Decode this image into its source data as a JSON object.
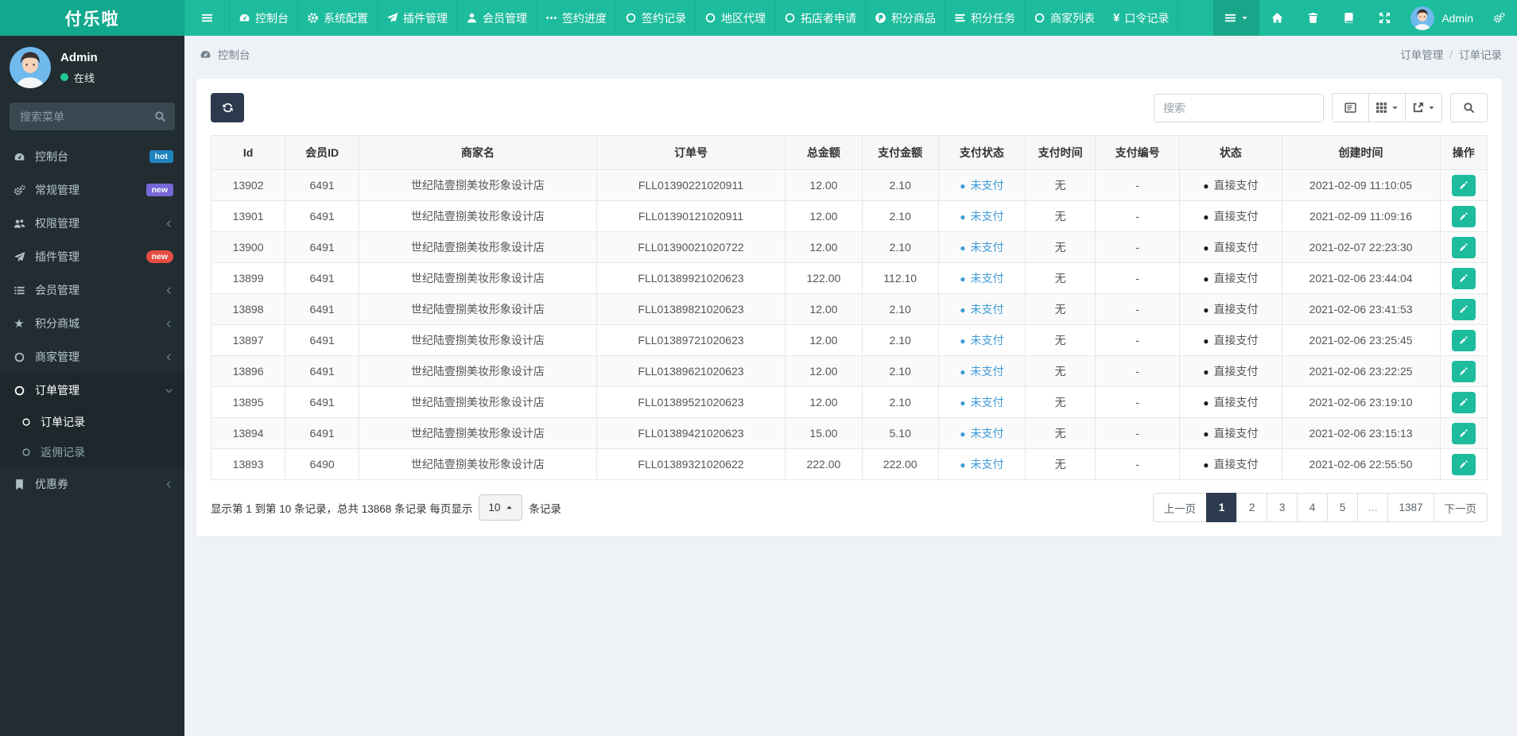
{
  "brand": {
    "name": "付乐啦"
  },
  "colors": {
    "navbar_teal": "#1dbc9d",
    "logo_teal": "#12a88d",
    "sidebar_dark": "#222d32",
    "page_bg": "#eef2f6",
    "accent_green": "#1dbc9c",
    "unpaid_blue": "#3f9bd8",
    "pagination_active": "#2c3b4e",
    "badge_hot": "#1f83bf",
    "badge_new_purple": "#7668d6",
    "badge_new_red": "#e64c42",
    "online_green": "#23c896"
  },
  "navbar": {
    "menu": [
      {
        "icon": "tachometer",
        "label": "控制台"
      },
      {
        "icon": "gear",
        "label": "系统配置"
      },
      {
        "icon": "plane",
        "label": "插件管理"
      },
      {
        "icon": "user",
        "label": "会员管理"
      },
      {
        "icon": "ellipsis",
        "label": "签约进度"
      },
      {
        "icon": "circle",
        "label": "签约记录"
      },
      {
        "icon": "circle",
        "label": "地区代理"
      },
      {
        "icon": "circle",
        "label": "拓店者申请"
      },
      {
        "icon": "p-circle",
        "label": "积分商品"
      },
      {
        "icon": "tasks",
        "label": "积分任务"
      },
      {
        "icon": "circle",
        "label": "商家列表"
      },
      {
        "icon": "yen",
        "label": "口令记录"
      }
    ],
    "admin_label": "Admin"
  },
  "sidebar": {
    "user": {
      "name": "Admin",
      "status": "在线"
    },
    "search_placeholder": "搜索菜单",
    "menu": [
      {
        "icon": "tachometer",
        "label": "控制台",
        "badge": "hot",
        "badge_color": "#1f83bf"
      },
      {
        "icon": "cogs",
        "label": "常规管理",
        "badge": "new",
        "badge_color": "#7668d6"
      },
      {
        "icon": "users",
        "label": "权限管理",
        "chevron": "left"
      },
      {
        "icon": "plane",
        "label": "插件管理",
        "badge": "new",
        "badge_color": "#e64c42",
        "badge_pill": true
      },
      {
        "icon": "list",
        "label": "会员管理",
        "chevron": "left"
      },
      {
        "icon": "star",
        "label": "积分商城",
        "chevron": "left"
      },
      {
        "icon": "circle",
        "label": "商家管理",
        "chevron": "left"
      },
      {
        "icon": "circle",
        "label": "订单管理",
        "chevron": "down",
        "active": true,
        "children": [
          {
            "label": "订单记录",
            "active": true
          },
          {
            "label": "返佣记录"
          }
        ]
      },
      {
        "icon": "bookmark",
        "label": "优惠券",
        "chevron": "left"
      }
    ]
  },
  "breadcrumb": {
    "left": "控制台",
    "right": [
      "订单管理",
      "订单记录"
    ],
    "separator": "/"
  },
  "toolbar": {
    "search_placeholder": "搜索"
  },
  "table": {
    "columns": [
      "Id",
      "会员ID",
      "商家名",
      "订单号",
      "总金额",
      "支付金额",
      "支付状态",
      "支付时间",
      "支付编号",
      "状态",
      "创建时间",
      "操作"
    ],
    "rows": [
      {
        "id": "13902",
        "member_id": "6491",
        "merchant": "世纪陆壹捌美妆形象设计店",
        "order_no": "FLL01390221020911",
        "total": "12.00",
        "paid": "2.10",
        "pay_status": "未支付",
        "pay_time": "无",
        "pay_no": "-",
        "status": "直接支付",
        "created": "2021-02-09 11:10:05"
      },
      {
        "id": "13901",
        "member_id": "6491",
        "merchant": "世纪陆壹捌美妆形象设计店",
        "order_no": "FLL01390121020911",
        "total": "12.00",
        "paid": "2.10",
        "pay_status": "未支付",
        "pay_time": "无",
        "pay_no": "-",
        "status": "直接支付",
        "created": "2021-02-09 11:09:16"
      },
      {
        "id": "13900",
        "member_id": "6491",
        "merchant": "世纪陆壹捌美妆形象设计店",
        "order_no": "FLL01390021020722",
        "total": "12.00",
        "paid": "2.10",
        "pay_status": "未支付",
        "pay_time": "无",
        "pay_no": "-",
        "status": "直接支付",
        "created": "2021-02-07 22:23:30"
      },
      {
        "id": "13899",
        "member_id": "6491",
        "merchant": "世纪陆壹捌美妆形象设计店",
        "order_no": "FLL01389921020623",
        "total": "122.00",
        "paid": "112.10",
        "pay_status": "未支付",
        "pay_time": "无",
        "pay_no": "-",
        "status": "直接支付",
        "created": "2021-02-06 23:44:04"
      },
      {
        "id": "13898",
        "member_id": "6491",
        "merchant": "世纪陆壹捌美妆形象设计店",
        "order_no": "FLL01389821020623",
        "total": "12.00",
        "paid": "2.10",
        "pay_status": "未支付",
        "pay_time": "无",
        "pay_no": "-",
        "status": "直接支付",
        "created": "2021-02-06 23:41:53"
      },
      {
        "id": "13897",
        "member_id": "6491",
        "merchant": "世纪陆壹捌美妆形象设计店",
        "order_no": "FLL01389721020623",
        "total": "12.00",
        "paid": "2.10",
        "pay_status": "未支付",
        "pay_time": "无",
        "pay_no": "-",
        "status": "直接支付",
        "created": "2021-02-06 23:25:45"
      },
      {
        "id": "13896",
        "member_id": "6491",
        "merchant": "世纪陆壹捌美妆形象设计店",
        "order_no": "FLL01389621020623",
        "total": "12.00",
        "paid": "2.10",
        "pay_status": "未支付",
        "pay_time": "无",
        "pay_no": "-",
        "status": "直接支付",
        "created": "2021-02-06 23:22:25"
      },
      {
        "id": "13895",
        "member_id": "6491",
        "merchant": "世纪陆壹捌美妆形象设计店",
        "order_no": "FLL01389521020623",
        "total": "12.00",
        "paid": "2.10",
        "pay_status": "未支付",
        "pay_time": "无",
        "pay_no": "-",
        "status": "直接支付",
        "created": "2021-02-06 23:19:10"
      },
      {
        "id": "13894",
        "member_id": "6491",
        "merchant": "世纪陆壹捌美妆形象设计店",
        "order_no": "FLL01389421020623",
        "total": "15.00",
        "paid": "5.10",
        "pay_status": "未支付",
        "pay_time": "无",
        "pay_no": "-",
        "status": "直接支付",
        "created": "2021-02-06 23:15:13"
      },
      {
        "id": "13893",
        "member_id": "6490",
        "merchant": "世纪陆壹捌美妆形象设计店",
        "order_no": "FLL01389321020622",
        "total": "222.00",
        "paid": "222.00",
        "pay_status": "未支付",
        "pay_time": "无",
        "pay_no": "-",
        "status": "直接支付",
        "created": "2021-02-06 22:55:50"
      }
    ]
  },
  "footer": {
    "summary_prefix": "显示第 1 到第 10 条记录，总共 13868 条记录 每页显示",
    "page_size": "10",
    "summary_suffix": "条记录",
    "pagination": [
      "上一页",
      "1",
      "2",
      "3",
      "4",
      "5",
      "...",
      "1387",
      "下一页"
    ],
    "active_page": "1"
  }
}
